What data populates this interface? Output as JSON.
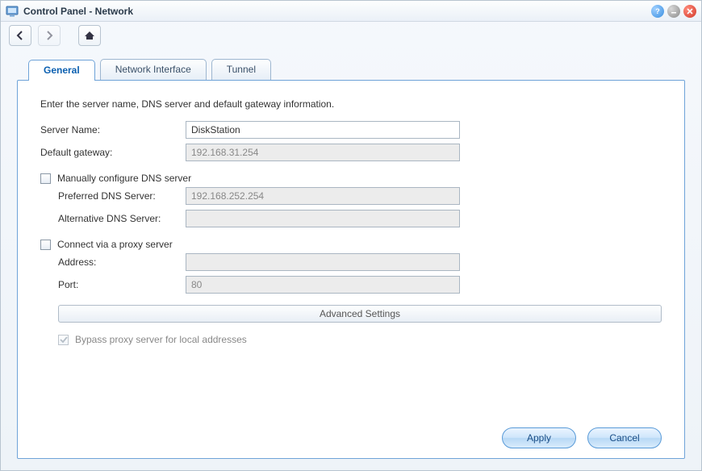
{
  "window": {
    "title": "Control Panel - Network"
  },
  "tabs": {
    "general": "General",
    "network_interface": "Network Interface",
    "tunnel": "Tunnel"
  },
  "intro": "Enter the server name, DNS server and default gateway information.",
  "labels": {
    "server_name": "Server Name:",
    "default_gateway": "Default gateway:",
    "manual_dns": "Manually configure DNS server",
    "preferred_dns": "Preferred DNS Server:",
    "alt_dns": "Alternative DNS Server:",
    "proxy": "Connect via a proxy server",
    "address": "Address:",
    "port": "Port:",
    "advanced": "Advanced Settings",
    "bypass": "Bypass proxy server for local addresses"
  },
  "values": {
    "server_name": "DiskStation",
    "default_gateway": "192.168.31.254",
    "preferred_dns": "192.168.252.254",
    "alt_dns": "",
    "address": "",
    "port": "80"
  },
  "buttons": {
    "apply": "Apply",
    "cancel": "Cancel"
  }
}
